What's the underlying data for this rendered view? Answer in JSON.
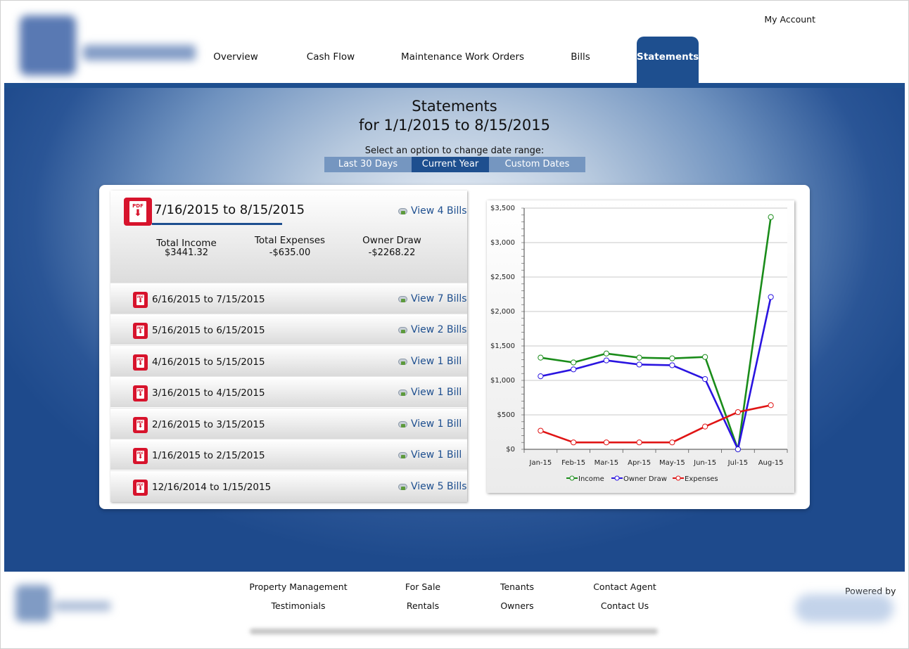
{
  "header": {
    "my_account": "My Account",
    "nav": [
      {
        "label": "Overview"
      },
      {
        "label": "Cash Flow"
      },
      {
        "label": "Maintenance Work Orders"
      },
      {
        "label": "Bills"
      },
      {
        "label": "Statements"
      }
    ],
    "active_tab": "Statements"
  },
  "page": {
    "title_line1": "Statements",
    "title_line2": "for 1/1/2015 to 8/15/2015",
    "select_label": "Select an option to change date range:",
    "range_options": [
      "Last 30 Days",
      "Current Year",
      "Custom Dates"
    ],
    "selected_range": "Current Year"
  },
  "current_statement": {
    "range": "7/16/2015 to 8/15/2015",
    "view_link": "View 4 Bills",
    "total_income_label": "Total Income",
    "total_income": "$3441.32",
    "total_expenses_label": "Total Expenses",
    "total_expenses": "-$635.00",
    "owner_draw_label": "Owner Draw",
    "owner_draw": "-$2268.22"
  },
  "statements": [
    {
      "range": "6/16/2015 to 7/15/2015",
      "view_link": "View 7 Bills"
    },
    {
      "range": "5/16/2015 to 6/15/2015",
      "view_link": "View 2 Bills"
    },
    {
      "range": "4/16/2015 to 5/15/2015",
      "view_link": "View 1 Bill"
    },
    {
      "range": "3/16/2015 to 4/15/2015",
      "view_link": "View 1 Bill"
    },
    {
      "range": "2/16/2015 to 3/15/2015",
      "view_link": "View 1 Bill"
    },
    {
      "range": "1/16/2015 to 2/15/2015",
      "view_link": "View 1 Bill"
    },
    {
      "range": "12/16/2014 to 1/15/2015",
      "view_link": "View 5 Bills"
    }
  ],
  "chart_data": {
    "type": "line",
    "categories": [
      "Jan-15",
      "Feb-15",
      "Mar-15",
      "Apr-15",
      "May-15",
      "Jun-15",
      "Jul-15",
      "Aug-15"
    ],
    "series": [
      {
        "name": "Income",
        "color": "#1a8c1a",
        "values": [
          1330,
          1260,
          1390,
          1330,
          1320,
          1340,
          0,
          3370
        ]
      },
      {
        "name": "Owner Draw",
        "color": "#2a14e0",
        "values": [
          1060,
          1160,
          1290,
          1230,
          1220,
          1020,
          0,
          2210
        ]
      },
      {
        "name": "Expenses",
        "color": "#e01414",
        "values": [
          270,
          100,
          100,
          100,
          100,
          330,
          540,
          640
        ]
      }
    ],
    "ylim": [
      0,
      3500
    ],
    "y_ticks": [
      0,
      500,
      1000,
      1500,
      2000,
      2500,
      3000,
      3500
    ],
    "y_tick_labels": [
      "$0",
      "$500",
      "$1,000",
      "$1,500",
      "$2,000",
      "$2,500",
      "$3,000",
      "$3,500"
    ],
    "grid": true,
    "legend_position": "bottom"
  },
  "footer": {
    "links": [
      "Property Management",
      "For Sale",
      "Tenants",
      "Contact Agent",
      "Testimonials",
      "Rentals",
      "Owners",
      "Contact Us"
    ],
    "powered_by": "Powered by"
  },
  "icons": {
    "pdf": "pdf-download-icon",
    "bills": "bills-cloud-icon"
  },
  "colors": {
    "brand_blue": "#1e4f8f",
    "pdf_red": "#d7132c"
  }
}
